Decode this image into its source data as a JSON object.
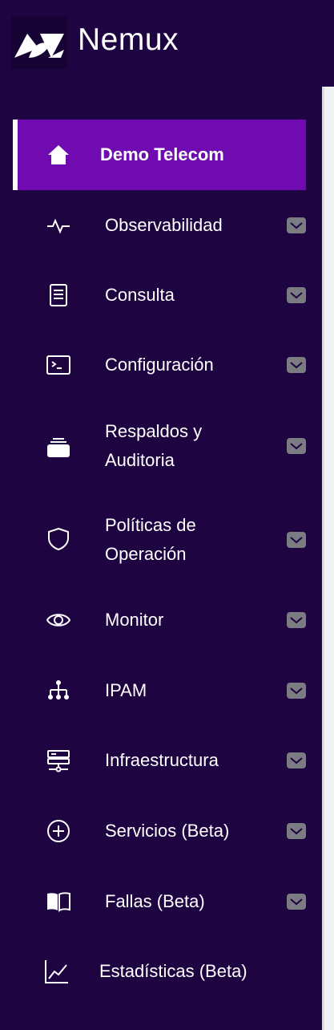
{
  "brand": {
    "name": "Nemux"
  },
  "colors": {
    "background": "#1e0440",
    "active": "#6f0bb0",
    "text": "#ffffff",
    "chevron": "#7a7c82"
  },
  "nav": [
    {
      "label": "Demo Telecom",
      "icon": "home-icon",
      "active": true,
      "expandable": false
    },
    {
      "label": "Observabilidad",
      "icon": "pulse-icon",
      "expandable": true
    },
    {
      "label": "Consulta",
      "icon": "document-icon",
      "expandable": true
    },
    {
      "label": "Configuración",
      "icon": "terminal-icon",
      "expandable": true
    },
    {
      "label_line1": "Respaldos y",
      "label_line2": "Auditoria",
      "icon": "archive-icon",
      "expandable": true
    },
    {
      "label_line1": "Políticas de",
      "label_line2": "Operación",
      "icon": "shield-icon",
      "expandable": true
    },
    {
      "label": "Monitor",
      "icon": "eye-icon",
      "expandable": true
    },
    {
      "label": "IPAM",
      "icon": "network-tree-icon",
      "expandable": true
    },
    {
      "label": "Infraestructura",
      "icon": "server-icon",
      "expandable": true
    },
    {
      "label": "Servicios (Beta)",
      "icon": "plus-circle-icon",
      "expandable": true
    },
    {
      "label": "Fallas (Beta)",
      "icon": "book-icon",
      "expandable": true
    },
    {
      "label": "Estadísticas (Beta)",
      "icon": "chart-line-icon",
      "expandable": false
    }
  ]
}
